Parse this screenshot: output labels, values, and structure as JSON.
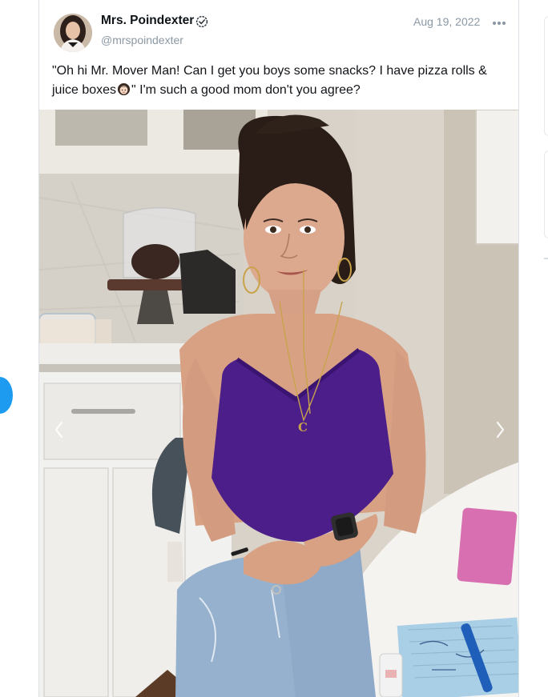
{
  "post": {
    "author": {
      "display_name": "Mrs. Poindexter",
      "handle": "@mrspoindexter",
      "avatar_icon": "profile-photo",
      "verified_icon": "verified-badge-icon"
    },
    "date": "Aug 19, 2022",
    "more_icon": "more-horizontal-icon",
    "text_part1": "\"Oh hi Mr. Mover Man! Can I get you boys some snacks? I have pizza rolls & juice boxes",
    "text_emoji": "woman-emoji",
    "text_part2": "\" I'm such a good mom don't you agree?"
  },
  "media": {
    "type": "photo",
    "prev_icon": "chevron-left-icon",
    "next_icon": "chevron-right-icon"
  },
  "colors": {
    "accent": "#1d9bf0",
    "text": "#0f1419",
    "muted": "#8b98a5",
    "top_color": "#4b1e8a"
  }
}
